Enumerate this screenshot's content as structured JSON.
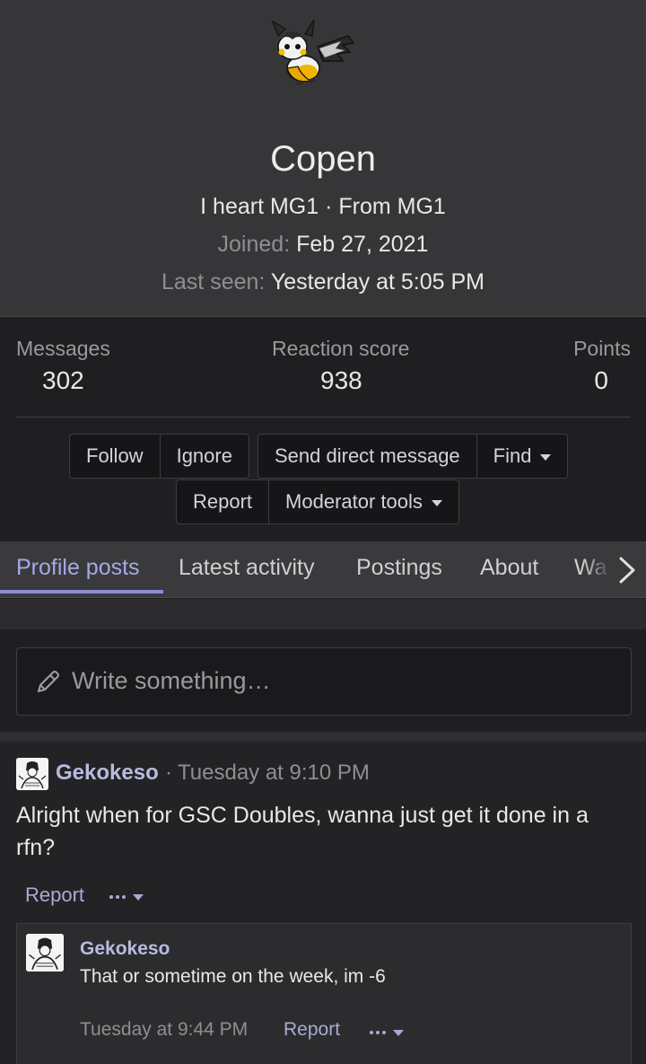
{
  "profile": {
    "username": "Copen",
    "tagline": "I heart MG1 · From MG1",
    "joined_label": "Joined:",
    "joined_value": "Feb 27, 2021",
    "last_seen_label": "Last seen:",
    "last_seen_value": "Yesterday at 5:05 PM",
    "avatar_icon": "emolga-sprite-icon"
  },
  "stats": [
    {
      "label": "Messages",
      "value": "302"
    },
    {
      "label": "Reaction score",
      "value": "938"
    },
    {
      "label": "Points",
      "value": "0"
    }
  ],
  "actions": {
    "follow": "Follow",
    "ignore": "Ignore",
    "send_dm": "Send direct message",
    "find": "Find",
    "report": "Report",
    "moderator_tools": "Moderator tools"
  },
  "tabs": [
    {
      "label": "Profile posts",
      "active": true
    },
    {
      "label": "Latest activity",
      "active": false
    },
    {
      "label": "Postings",
      "active": false
    },
    {
      "label": "About",
      "active": false
    },
    {
      "label": "Wa",
      "active": false
    }
  ],
  "composer": {
    "placeholder": "Write something…",
    "icon": "pencil-icon"
  },
  "post": {
    "author": "Gekokeso",
    "separator": "·",
    "time": "Tuesday at 9:10 PM",
    "body": "Alright when for GSC Doubles, wanna just get it done in a rfn?",
    "report": "Report",
    "comment": {
      "author": "Gekokeso",
      "body": "That or sometime on the week, im -6",
      "time": "Tuesday at 9:44 PM",
      "report": "Report"
    }
  },
  "colors": {
    "header_bg": "#363638",
    "page_bg": "#1f1f21",
    "accent": "#8a8cd6",
    "link": "#a8abd6"
  }
}
